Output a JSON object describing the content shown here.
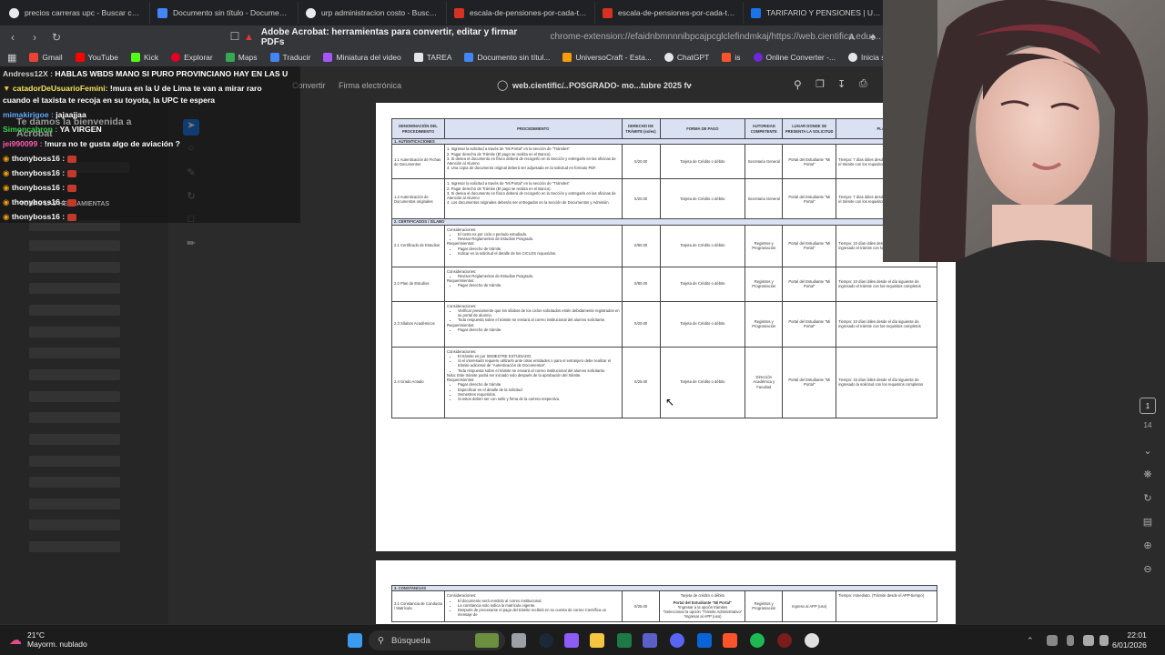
{
  "tabs": [
    {
      "title": "precios carreras upc - Buscar con Go",
      "color": "#e8eaed"
    },
    {
      "title": "Documento sin título - Documentos",
      "color": "#4285f4"
    },
    {
      "title": "urp administracion costo - Buscar co",
      "color": "#e8eaed"
    },
    {
      "title": "escala-de-pensiones-por-cada-tipo-",
      "color": "#d93025"
    },
    {
      "title": "escala-de-pensiones-por-cada-tipo-",
      "color": "#d93025"
    },
    {
      "title": "TARIFARIO Y PENSIONES | Universid",
      "color": "#1a73e8"
    }
  ],
  "omnibox": {
    "title": "Adobe Acrobat: herramientas para convertir, editar y firmar PDFs",
    "url": "chrome-extension://efaidnbmnnnibpcajpcglclefindmkaj/https://web.cientifica.edu...."
  },
  "bookmarks": [
    {
      "label": "Gmail",
      "color": "#ea4335"
    },
    {
      "label": "YouTube",
      "color": "#ff0000"
    },
    {
      "label": "Kick",
      "color": "#53fc18"
    },
    {
      "label": "Explorar",
      "color": "#e60023"
    },
    {
      "label": "Maps",
      "color": "#34a853"
    },
    {
      "label": "Traducir",
      "color": "#4285f4"
    },
    {
      "label": "Miniatura del video",
      "color": "#a855f7"
    },
    {
      "label": "TAREA",
      "color": "#ffffff"
    },
    {
      "label": "Documento sin títul...",
      "color": "#4285f4"
    },
    {
      "label": "UniversoCraft - Esta...",
      "color": "#f59e0b"
    },
    {
      "label": "ChatGPT",
      "color": "#e5e5e5"
    },
    {
      "label": "is",
      "color": "#fb542b"
    },
    {
      "label": "Online Converter -...",
      "color": "#6d28d9"
    },
    {
      "label": "Inicia sesión: Cuen",
      "color": "#e5e5e5"
    }
  ],
  "pdf_toolbar": {
    "convert": "Convertir",
    "sign": "Firma electrónica",
    "site": "web.cientific...",
    "doc": "POSGRADO- mo...tubre 2025 fv"
  },
  "chat": {
    "m1_user": "Andress12X :",
    "m1_text": "HABLAS WBDS MANO SI PURO PROVINCIANO HAY EN LAS U",
    "m2_user": "catadorDeUsuarioFemini:",
    "m2_text": "!mura en la U de Lima te van a mirar raro",
    "m3_text": "cuando el taxista te recoja en su toyota, la UPC te espera",
    "m4_user": "mimakirigoe :",
    "m4_text": "jajaajjaa",
    "m5_user": "Simoncabron :",
    "m5_text": "YA VIRGEN",
    "m6_user": "jei990099 :",
    "m6_text": "!mura no te gusta algo de aviación ?",
    "spam_user": "thonyboss16 :",
    "ghost_welcome": "Te damos la bienvenida a",
    "ghost_acrobat": "Acrobat",
    "ghost_tools": "TODAS LAS HERRAMIENTAS"
  },
  "right_rail": {
    "page": "1",
    "total": "14"
  },
  "table1": {
    "headers": [
      "DENOMINACIÓN DEL PROCEDIMIENTO",
      "PROCEDIMIENTO",
      "DERECHO DE TRÁMITE (soles)",
      "FORMA DE PAGO",
      "AUTORIDAD COMPETENTE",
      "LUGAR DONDE SE PRESENTA LA SOLICITUD",
      "PLAZO DE"
    ],
    "sect1": "1. AUTENTICACIONES",
    "sect2": "2. CERTIFICADOS / SÍLABO",
    "r1": {
      "name": "1.1 Autenticación de Fichas de Documentos",
      "steps": [
        "1. Ingresar la solicitud a través de \"Mi Portal\" en la sección de \"Trámites\"",
        "2. Pagar derecho de Trámite (El pago se realiza en el Banco).",
        "3. Si desea el documento en físico deberá de recogerlo en la Sección y entregarlo en las oficinas de Atención al Alumno",
        "4. Una copia de documento original deberá ser adjuntada en la solicitud en formato PDF."
      ],
      "fee": "S/20.00",
      "pay": "Tarjeta de Crédito o débito",
      "auth": "Secretaria General",
      "place": "Portal del Estudiante \"Mi Portal\"",
      "time": "Tiempo: 7 días útiles desde el día siguiente de ingresado el trámite con los requisitos completos"
    },
    "r2": {
      "name": "1.2 Autenticación de Documentos originales",
      "steps": [
        "1. Ingresar la solicitud a través de \"Mi Portal\" en la sección de \"Trámites\"",
        "2. Pagar derecho de Trámite (El pago se realiza en el Banco).",
        "3. Si desea el documento en físico deberá de recogerlo en la Sección y entregarlo en las oficinas de Atención al Alumno",
        "4. Los documentos originales deberán ser entregados en la sección de Documentos y Admisión."
      ],
      "fee": "S/20.00",
      "pay": "Tarjeta de Crédito o débito",
      "auth": "Secretaria General",
      "place": "Portal del Estudiante \"Mi Portal\"",
      "time": "Tiempo: 7 días útiles desde el día siguiente de ingresado el trámite con los requisitos completos"
    },
    "r3": {
      "name": "2.1 Certificado de Estudios",
      "cons": "Consideraciones:",
      "bul1": [
        "El costo es por ciclo o periodo estudiado.",
        "Revisar Reglamentos de Estudios Posgrado."
      ],
      "req": "Requerimientos:",
      "bul2": [
        "Pagar derecho de trámite.",
        "Indicar en la solicitud el detalle de los CICLOS requeridos."
      ],
      "fee": "S/80.00",
      "pay": "Tarjeta de Crédito o débito",
      "auth": "Registros y Programación",
      "place": "Portal del Estudiante \"Mi Portal\"",
      "time": "Tiempo: 10 días útiles desde el día siguiente de ingresado el trámite con los requisitos completos"
    },
    "r4": {
      "name": "2.2 Plan de Estudios",
      "cons": "Consideraciones:",
      "bul1": [
        "Revisar Reglamentos de Estudios Posgrado."
      ],
      "req": "Requerimientos:",
      "bul2": [
        "Pagar derecho de trámite."
      ],
      "fee": "S/80.00",
      "pay": "Tarjeta de Crédito o débito",
      "auth": "Registros y Programación",
      "place": "Portal del Estudiante \"Mi Portal\"",
      "time": "Tiempo: 10 días útiles desde el día siguiente de ingresado el trámite con los requisitos completos"
    },
    "r5": {
      "name": "2.3 Sílabos Académicos",
      "cons": "Consideraciones:",
      "bul1": [
        "Verificar previamente que los sílabos de los ciclos solicitados estén debidamente registrados en su portal de alumno.",
        "Toda respuesta sobre el trámite se enviará al correo institucional del alumno solicitante."
      ],
      "req": "Requerimientos:",
      "bul2": [
        "Pagar derecho de trámite."
      ],
      "fee": "S/20.00",
      "pay": "Tarjeta de Crédito o débito",
      "auth": "Registros y Programación",
      "place": "Portal del Estudiante \"Mi Portal\"",
      "time": "Tiempo: 10 días útiles desde el día siguiente de ingresado el trámite con los requisitos completos"
    },
    "r6": {
      "name": "2.4 Grado Actado",
      "cons": "Consideraciones:",
      "bul1": [
        "El trámite es por SEMESTRE ESTUDIADO.",
        "Si el interesado requiere utilizarlo ante otras entidades o para el extranjero debe realizar el trámite adicional de \"Autenticación de Documentos\".",
        "Toda respuesta sobre el trámite se enviará al correo institucional del alumno solicitante."
      ],
      "note": "Nota: Este trámite podrá ser iniciado solo después de la aprobación del trámite.",
      "req": "Requerimientos:",
      "bul2": [
        "Pagar derecho de trámite.",
        "Especificar en el detalle de la solicitud",
        "Semestres requeridos.",
        "Si estos deben ser con sello y firma de la carrera respectiva."
      ],
      "fee": "S/25.00",
      "pay": "Tarjeta de Crédito o débito",
      "auth": "Dirección Académica y Facultad",
      "place": "Portal del Estudiante \"Mi Portal\"",
      "time": "Tiempo: 15 días útiles desde el día siguiente de ingresado la solicitud con los requisitos completos"
    }
  },
  "table2": {
    "sect": "3. CONSTANCIAS",
    "name": "3.1 Constancia de Conducta / Matrícula",
    "cons": "Consideraciones:",
    "bul1": [
      "El documento será remitido al correo institucional.",
      "La constancia solo indica la matrícula vigente.",
      "Después de procesarse el pago del trámite recibirá en su cuenta de correo Científica un mensaje de"
    ],
    "fee": "S/25.00",
    "pay": "Tarjeta de crédito o débito",
    "portal_title": "Portal del Estudiante \"Mi Portal\"",
    "portal_l1": "*Ingresar a la opción trámites",
    "portal_l2": "*Seleccionar la opción \"Trámite Administrativo\"",
    "portal_l3": "*Ingresar al APP (uso)",
    "auth": "Registros y Programación",
    "place": "Ingreso al APP (uso)",
    "time": "Tiempo: Inmediato. (Trámite desde el APP-tiempo)"
  },
  "taskbar": {
    "temp": "21°C",
    "weather": "Mayorm. nublado",
    "search": "Búsqueda",
    "time": "22:01",
    "date": "6/01/2026"
  }
}
